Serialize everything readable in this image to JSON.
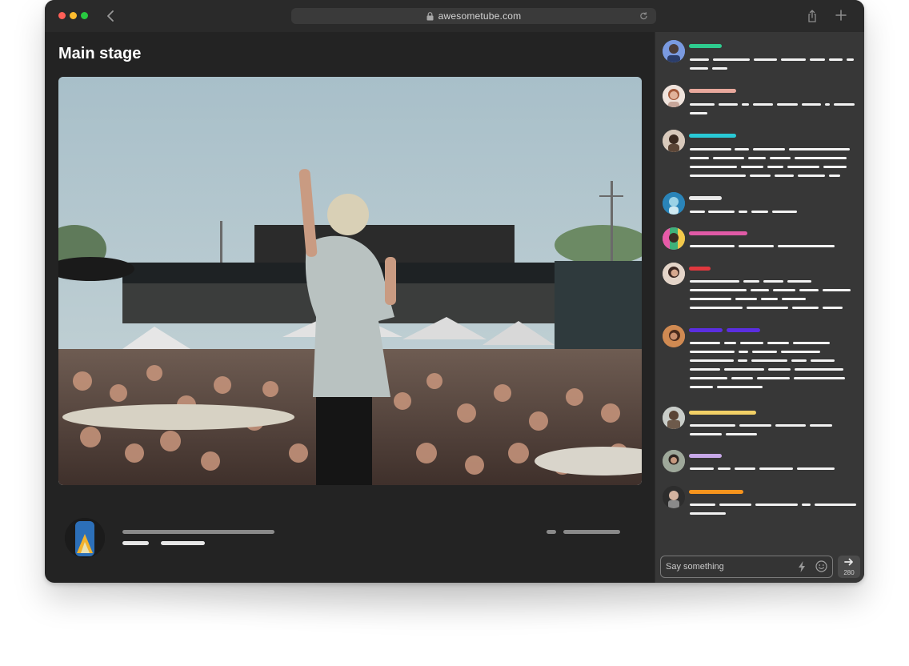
{
  "window": {
    "url": "awesometube.com",
    "traffic_lights": {
      "close": "#ff5f57",
      "minimize": "#febc2e",
      "zoom": "#28c840"
    }
  },
  "main": {
    "title": "Main stage"
  },
  "chat": {
    "input_placeholder": "Say something",
    "char_count": "280",
    "username_colors": [
      "#2ecc8f",
      "#e8a89c",
      "#29c9d6",
      "#e8e8e8",
      "#e05aa6",
      "#e0383e",
      "#5b2ee0",
      "#f2d066",
      "#c7a8e8",
      "#f7941d"
    ]
  },
  "icons": [
    "back-icon",
    "lock-icon",
    "reload-icon",
    "share-icon",
    "plus-icon",
    "bolt-icon",
    "smile-icon",
    "send-arrow-icon"
  ]
}
